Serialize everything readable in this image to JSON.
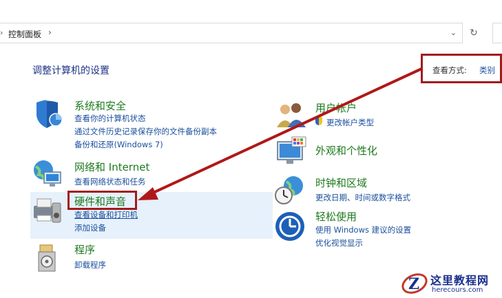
{
  "address": {
    "breadcrumb": "控制面板",
    "separator": "›"
  },
  "page_title": "调整计算机的设置",
  "view_by": {
    "label": "查看方式:",
    "value": "类别"
  },
  "categories": {
    "system": {
      "title": "系统和安全",
      "links": [
        "查看你的计算机状态",
        "通过文件历史记录保存你的文件备份副本",
        "备份和还原(Windows 7)"
      ]
    },
    "network": {
      "title": "网络和 Internet",
      "links": [
        "查看网络状态和任务"
      ]
    },
    "hardware": {
      "title": "硬件和声音",
      "links": [
        "查看设备和打印机",
        "添加设备"
      ]
    },
    "programs": {
      "title": "程序",
      "links": [
        "卸载程序"
      ]
    },
    "users": {
      "title": "用户帐户",
      "links": [
        "更改帐户类型"
      ]
    },
    "appearance": {
      "title": "外观和个性化",
      "links": []
    },
    "clock": {
      "title": "时钟和区域",
      "links": [
        "更改日期、时间或数字格式"
      ]
    },
    "ease": {
      "title": "轻松使用",
      "links": [
        "使用 Windows 建议的设置",
        "优化视觉显示"
      ]
    }
  },
  "watermark": {
    "title": "这里教程网",
    "url": "herecours.com"
  },
  "colors": {
    "highlight_box": "#a11a1a",
    "category_title": "#1e7a1e",
    "link": "#1a4f9c",
    "hover_bg": "#e6f1fb"
  }
}
